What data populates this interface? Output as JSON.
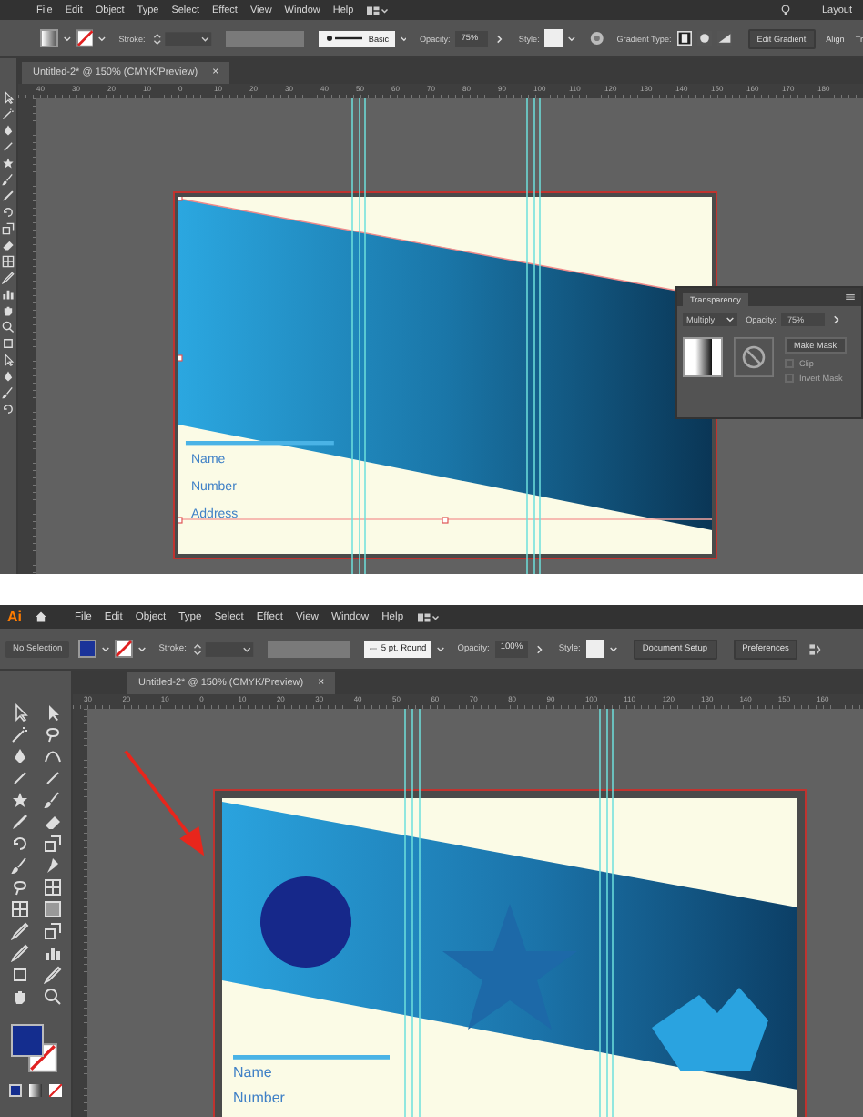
{
  "screens": [
    {
      "kind": "collapsed",
      "menu": [
        "File",
        "Edit",
        "Object",
        "Type",
        "Select",
        "Effect",
        "View",
        "Window",
        "Help"
      ],
      "menu_right": "Layout",
      "controls": [
        {
          "kind": "gradient-fill"
        },
        {
          "kind": "no-stroke"
        },
        {
          "kind": "label",
          "text": "Stroke:"
        },
        {
          "kind": "spinner"
        },
        {
          "kind": "field"
        },
        {
          "kind": "brush",
          "text": "Basic"
        },
        {
          "kind": "label",
          "text": "Opacity:"
        },
        {
          "kind": "value",
          "text": "75%"
        },
        {
          "kind": "chevron"
        },
        {
          "kind": "label",
          "text": "Style:"
        },
        {
          "kind": "style"
        },
        {
          "kind": "recolor"
        },
        {
          "kind": "label",
          "text": "Gradient Type:"
        },
        {
          "kind": "gradient-types"
        },
        {
          "kind": "button",
          "text": "Edit Gradient"
        },
        {
          "kind": "link",
          "text": "Align"
        },
        {
          "kind": "link",
          "text": "Tr"
        }
      ],
      "document_tab": {
        "title": "Untitled-2* @ 150% (CMYK/Preview)",
        "close": "×"
      },
      "ruler": [
        "40",
        "30",
        "20",
        "10",
        "0",
        "10",
        "20",
        "30",
        "40",
        "50",
        "60",
        "70",
        "80",
        "90",
        "100",
        "110",
        "120",
        "130",
        "140",
        "150",
        "160",
        "170",
        "180"
      ],
      "artboard": {
        "kind": "band",
        "fields": [
          "Name",
          "Number",
          "Address"
        ]
      },
      "panel": {
        "title": "Transparency",
        "blend_mode": "Multiply",
        "opacity_label": "Opacity:",
        "opacity": "75%",
        "make_mask": "Make Mask",
        "options": [
          {
            "label": "Clip",
            "checked": false,
            "disabled": true
          },
          {
            "label": "Invert Mask",
            "checked": false,
            "disabled": true
          }
        ]
      }
    },
    {
      "kind": "expanded",
      "logo": "Ai",
      "menu": [
        "File",
        "Edit",
        "Object",
        "Type",
        "Select",
        "Effect",
        "View",
        "Window",
        "Help"
      ],
      "controls": [
        {
          "kind": "status",
          "text": "No Selection"
        },
        {
          "kind": "solid-fill"
        },
        {
          "kind": "no-stroke"
        },
        {
          "kind": "label",
          "text": "Stroke:"
        },
        {
          "kind": "spinner"
        },
        {
          "kind": "field"
        },
        {
          "kind": "brush",
          "text": "5 pt. Round"
        },
        {
          "kind": "label",
          "text": "Opacity:"
        },
        {
          "kind": "value",
          "text": "100%"
        },
        {
          "kind": "chevron"
        },
        {
          "kind": "label",
          "text": "Style:"
        },
        {
          "kind": "style"
        },
        {
          "kind": "button",
          "text": "Document Setup"
        },
        {
          "kind": "button",
          "text": "Preferences"
        },
        {
          "kind": "panel-toggle"
        }
      ],
      "document_tab": {
        "title": "Untitled-2* @ 150% (CMYK/Preview)",
        "close": "×"
      },
      "ruler": [
        "30",
        "20",
        "10",
        "0",
        "10",
        "20",
        "30",
        "40",
        "50",
        "60",
        "70",
        "80",
        "90",
        "100",
        "110",
        "120",
        "130",
        "140",
        "150",
        "160"
      ],
      "artboard": {
        "kind": "shapes",
        "fields": [
          "Name",
          "Number"
        ]
      },
      "arrow": true
    }
  ]
}
